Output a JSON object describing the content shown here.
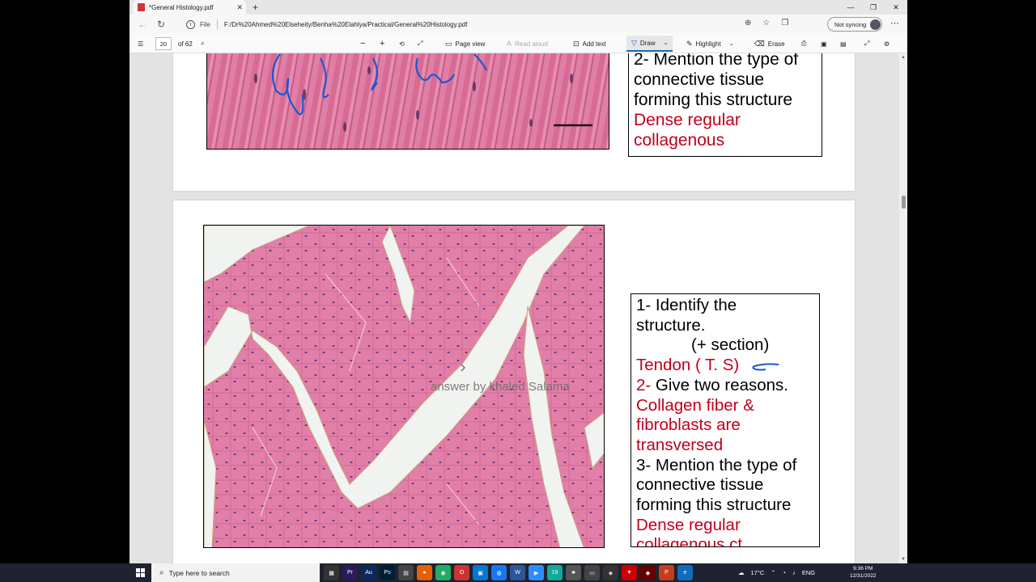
{
  "browser": {
    "tab_title": "*General Histology.pdf",
    "tab_close": "✕",
    "new_tab": "+",
    "url_scheme": "File",
    "url": "F:/Dr%20Ahmed%20Elseheity/Benha%20Elahlya/Practical/General%20Histology.pdf",
    "sync_label": "Not syncing",
    "window_controls": [
      "—",
      "❐",
      "✕"
    ]
  },
  "pdf_toolbar": {
    "page_number": "20",
    "page_total": "of 62",
    "page_view": "Page view",
    "read_aloud": "Read aloud",
    "add_text": "Add text",
    "draw": "Draw",
    "highlight": "Highlight",
    "erase": "Erase"
  },
  "page1": {
    "q2_line1": "2-  Mention the type of",
    "q2_line2": "connective tissue",
    "q2_line3": "forming this structure",
    "ans_line1": "Dense regular",
    "ans_line2": "collagenous"
  },
  "page2": {
    "q1_line1": "1- Identify the",
    "q1_line2": "structure.",
    "q1_line3": "(+ section)",
    "ans1": "Tendon ( T. S)",
    "q2_num": "2-",
    "q2_text": " Give two reasons.",
    "ans2_line1": "Collagen fiber &",
    "ans2_line2": "fibroblasts are",
    "ans2_line3": "transversed",
    "q3_line1": "3-  Mention the type of",
    "q3_line2": "connective tissue",
    "q3_line3": "forming this structure",
    "ans3_line1": "Dense regular",
    "ans3_line2": "collagenous ct",
    "watermark": "answer by khaled Salama"
  },
  "taskbar": {
    "search_placeholder": "Type here to search",
    "weather": "17°C",
    "language": "ENG",
    "time": "9:36 PM",
    "date": "12/31/2022"
  },
  "colors": {
    "answer_red": "#c0001b",
    "ink_blue": "#1a57d6",
    "accent": "#0f6cbd"
  },
  "icons": [
    "pdf-icon",
    "back-icon",
    "refresh-icon",
    "info-icon",
    "zoom-icon",
    "favorites-icon",
    "collections-icon",
    "more-icon",
    "toc-icon",
    "search-icon",
    "zoom-out-icon",
    "zoom-in-icon",
    "rotate-icon",
    "fit-icon",
    "draw-icon",
    "highlight-icon",
    "erase-icon",
    "print-icon",
    "save-icon",
    "save-as-icon",
    "fullscreen-icon",
    "settings-icon",
    "windows-icon"
  ]
}
